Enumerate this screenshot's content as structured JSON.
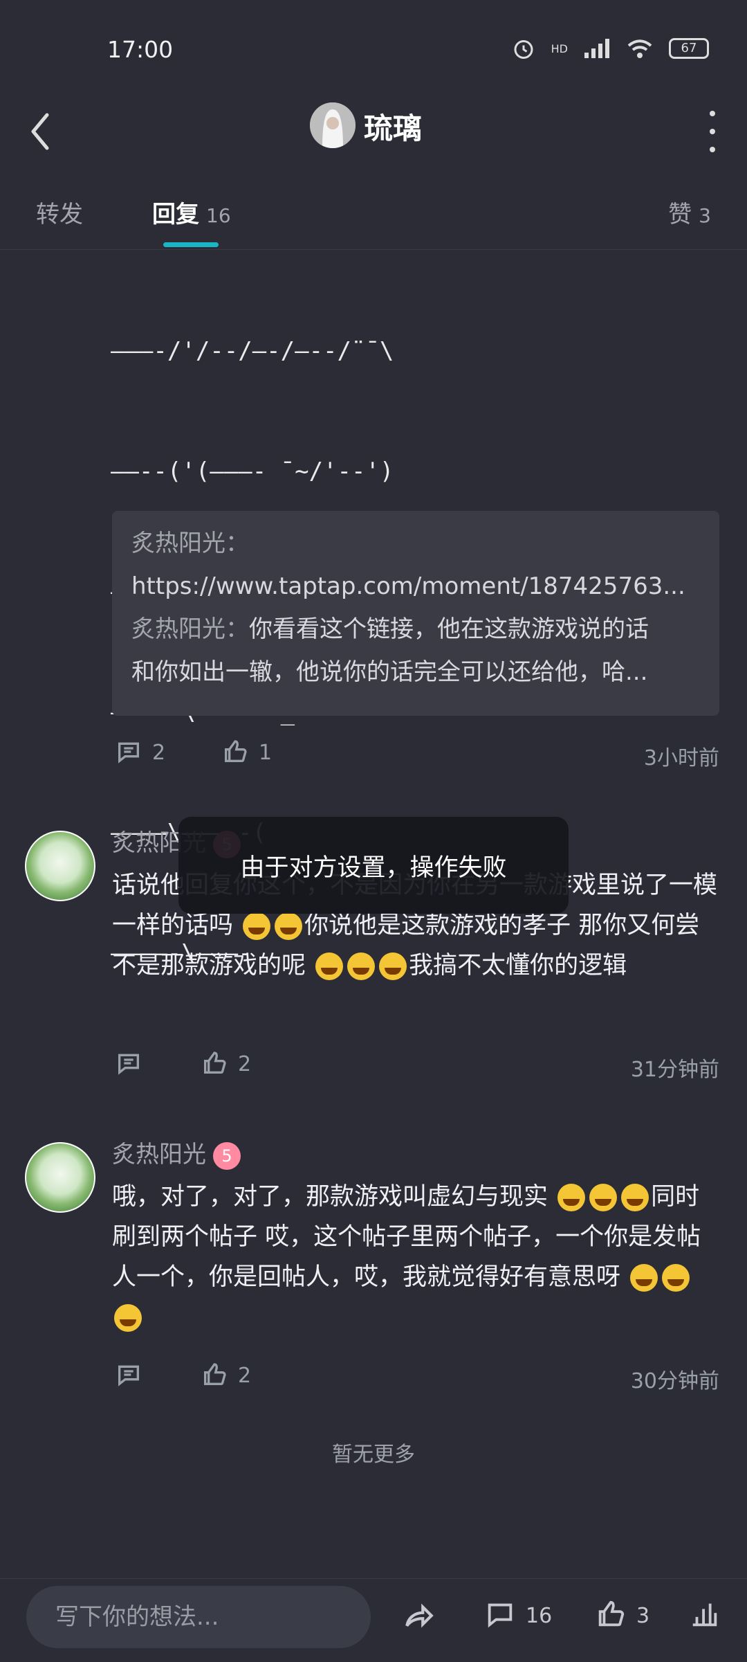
{
  "status_bar": {
    "time": "17:00",
    "battery": "67",
    "network": "HD"
  },
  "header": {
    "name": "琉璃"
  },
  "tabs": {
    "forward_label": "转发",
    "reply_label": "回复",
    "reply_count": "16",
    "likes_label": "赞",
    "likes_count": "3"
  },
  "ascii_art": [
    "———-/'/--/—-/—--/¨¯\\",
    "——--('(———- ¯~/'--')",
    "———\\————-'—--/",
    "———-'\\'———— _-·'",
    "————\\———--(",
    "————-\\———-"
  ],
  "quote": {
    "line1_user": "炙热阳光：",
    "line2": "https://www.taptap.com/moment/187425763...",
    "line3_user": "炙热阳光：",
    "line3_text": "你看看这个链接，他在这款游戏说的话",
    "line4": "和你如出一辙，他说你的话完全可以还给他，哈..."
  },
  "post_actions": {
    "comments": "2",
    "likes": "1",
    "time": "3小时前"
  },
  "comments": [
    {
      "user": "炙热阳光",
      "level": "5",
      "text_part1": "话说他回复你这个，不是因为你在另一款游戏里说了一模一样的话吗",
      "text_part2": "你说他是这款游戏的孝子 那你又何尝不是那款游戏的呢",
      "text_part3": "我搞不太懂你的逻辑",
      "likes": "2",
      "time": "31分钟前"
    },
    {
      "user": "炙热阳光",
      "level": "5",
      "text_part1": "哦，对了，对了，那款游戏叫虚幻与现实",
      "text_part2": "同时刷到两个帖子 哎，这个帖子里两个帖子，一个你是发帖人一个，你是回帖人，哎，我就觉得好有意思呀",
      "likes": "2",
      "time": "30分钟前"
    }
  ],
  "toast": "由于对方设置，操作失败",
  "no_more": "暂无更多",
  "bottom_bar": {
    "input_placeholder": "写下你的想法...",
    "comment_count": "16",
    "like_count": "3"
  },
  "icons": [
    "back-arrow-icon",
    "more-vertical-icon",
    "comment-icon",
    "thumbs-up-icon",
    "share-icon",
    "stats-icon",
    "alarm-icon",
    "signal-icon",
    "wifi-icon",
    "battery-icon"
  ]
}
